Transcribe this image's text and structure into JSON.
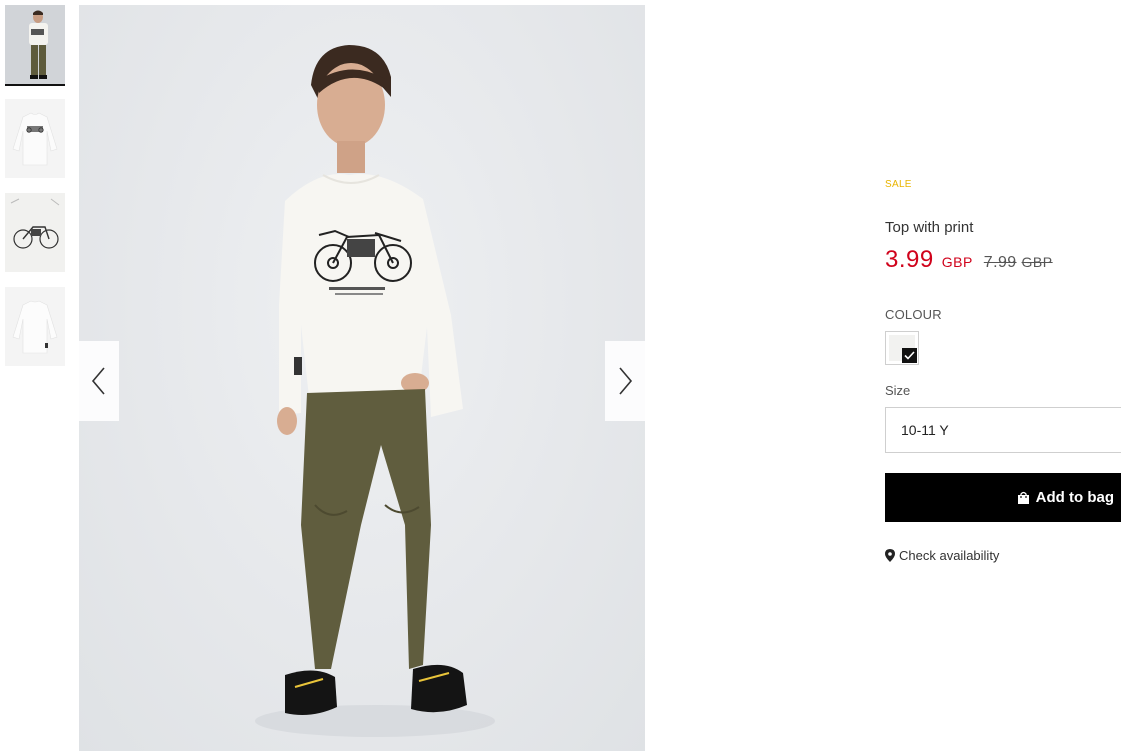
{
  "gallery": {
    "thumbnails": [
      {
        "name": "thumbnail-model",
        "icon": "model-photo",
        "active": true
      },
      {
        "name": "thumbnail-front",
        "icon": "tshirt-front",
        "active": false
      },
      {
        "name": "thumbnail-print-detail",
        "icon": "print-detail",
        "active": false
      },
      {
        "name": "thumbnail-back",
        "icon": "tshirt-back",
        "active": false
      }
    ],
    "prev_icon": "chevron-left-icon",
    "next_icon": "chevron-right-icon"
  },
  "product": {
    "badge": "SALE",
    "name": "Top with print",
    "price": {
      "current": "3.99",
      "currency": "GBP",
      "original": "7.99",
      "original_currency": "GBP"
    },
    "colour_label": "COLOUR",
    "selected_colour": "#f2f2f0",
    "size_label": "Size",
    "size_value": "10-11 Y",
    "add_to_bag_label": "Add to bag",
    "check_availability_label": "Check availability"
  },
  "colors": {
    "sale": "#e9b400",
    "price": "#d0021b",
    "button": "#000000"
  }
}
